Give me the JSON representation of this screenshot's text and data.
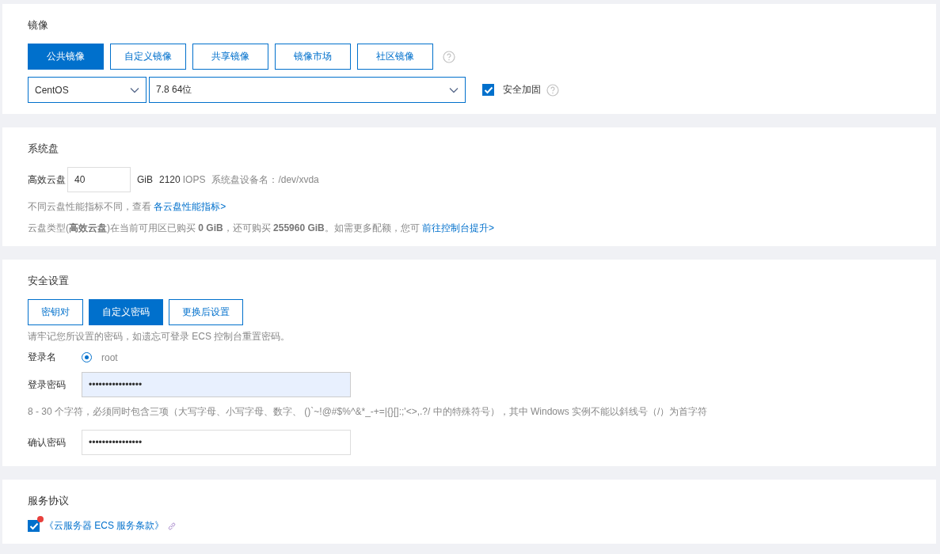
{
  "image": {
    "title": "镜像",
    "tabs": [
      {
        "label": "公共镜像",
        "selected": true
      },
      {
        "label": "自定义镜像",
        "selected": false
      },
      {
        "label": "共享镜像",
        "selected": false
      },
      {
        "label": "镜像市场",
        "selected": false
      },
      {
        "label": "社区镜像",
        "selected": false
      }
    ],
    "os_select": {
      "value": "CentOS"
    },
    "version_select": {
      "value": "7.8 64位"
    },
    "hardening": {
      "label": "安全加固",
      "checked": true
    }
  },
  "system_disk": {
    "title": "系统盘",
    "disk_type": "高效云盘",
    "size": "40",
    "unit": "GiB",
    "iops_value": "2120",
    "iops_unit": "IOPS",
    "device": "系统盘设备名：/dev/xvda",
    "perf_note": "不同云盘性能指标不同，查看",
    "perf_link": "各云盘性能指标>",
    "quota_note": "云盘类型(**高效云盘**)在当前可用区已购买 **0 GiB**，还可购买 **255960 GiB**。如需更多配额，您可",
    "quota_link": "前往控制台提升>"
  },
  "security": {
    "title": "安全设置",
    "tabs": [
      {
        "label": "密钥对",
        "selected": false
      },
      {
        "label": "自定义密码",
        "selected": true
      },
      {
        "label": "更换后设置",
        "selected": false
      }
    ],
    "note": "请牢记您所设置的密码，如遗忘可登录 ECS 控制台重置密码。",
    "login_name_label": "登录名",
    "login_name": {
      "label": "root",
      "selected": true
    },
    "password_label": "登录密码",
    "password": "••••••••••••••••",
    "password_hint": "8 - 30 个字符，必须同时包含三项（大写字母、小写字母、数字、 ()`~!@#$%^&*_-+=|{}[]:;'<>,.?/ 中的特殊符号），其中 Windows 实例不能以斜线号（/）为首字符",
    "confirm_label": "确认密码",
    "confirm": "••••••••••••••••"
  },
  "agreement": {
    "title": "服务协议",
    "checked": true,
    "alert": true,
    "link": "《云服务器 ECS 服务条款》"
  }
}
